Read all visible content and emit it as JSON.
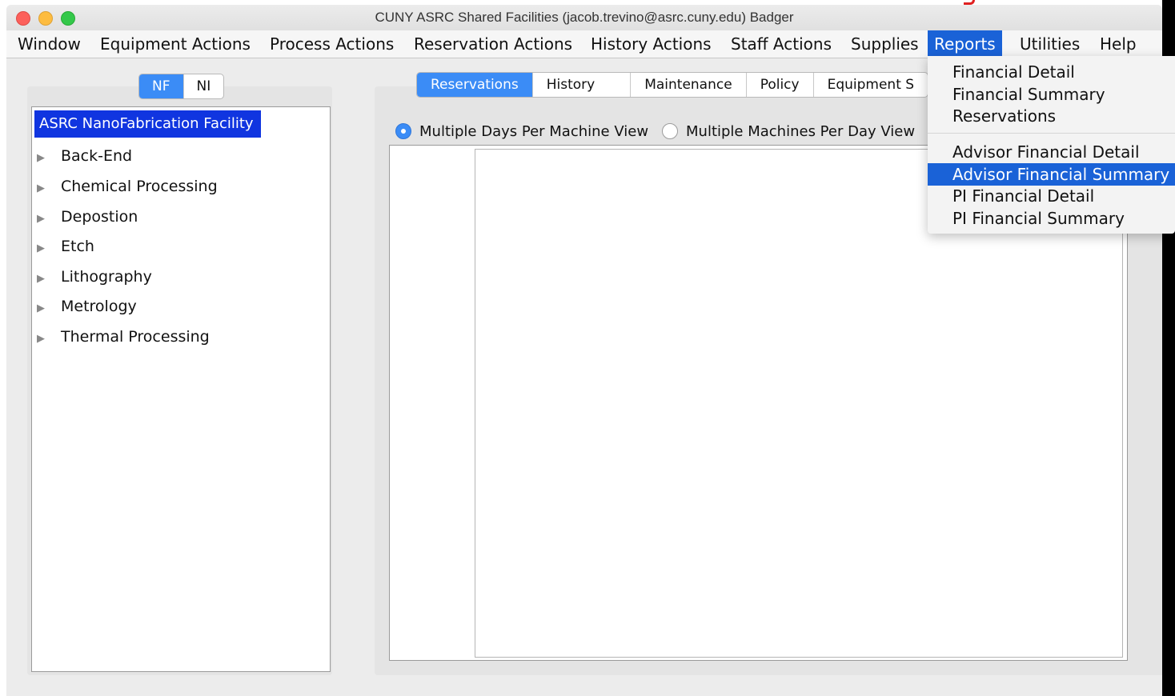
{
  "window": {
    "title": "CUNY ASRC Shared Facilities (jacob.trevino@asrc.cuny.edu) Badger"
  },
  "menubar": {
    "items": [
      "Window",
      "Equipment Actions",
      "Process Actions",
      "Reservation Actions",
      "History Actions",
      "Staff Actions",
      "Supplies",
      "Reports",
      "Utilities",
      "Help"
    ],
    "active": "Reports"
  },
  "facility_toggle": {
    "options": [
      "NF",
      "NI"
    ],
    "selected": "NF"
  },
  "tree": {
    "root": "ASRC NanoFabrication Facility",
    "nodes": [
      "Back-End",
      "Chemical Processing",
      "Depostion",
      "Etch",
      "Lithography",
      "Metrology",
      "Thermal Processing"
    ]
  },
  "tabs": {
    "items": [
      "Reservations",
      "History",
      "Maintenance",
      "Policy",
      "Equipment S"
    ],
    "selected": "Reservations"
  },
  "view_options": {
    "items": [
      "Multiple Days Per Machine View",
      "Multiple Machines Per Day View"
    ],
    "selected": "Multiple Days Per Machine View"
  },
  "reports_menu": {
    "group1": [
      "Financial Detail",
      "Financial Summary",
      "Reservations"
    ],
    "group2": [
      "Advisor Financial Detail",
      "Advisor Financial Summary",
      "PI Financial Detail",
      "PI Financial Summary"
    ],
    "highlighted": "Advisor Financial Summary"
  },
  "colors": {
    "accent": "#1a62d7",
    "tree_selection": "#1035e0",
    "segmented_on": "#3b8cf6"
  }
}
